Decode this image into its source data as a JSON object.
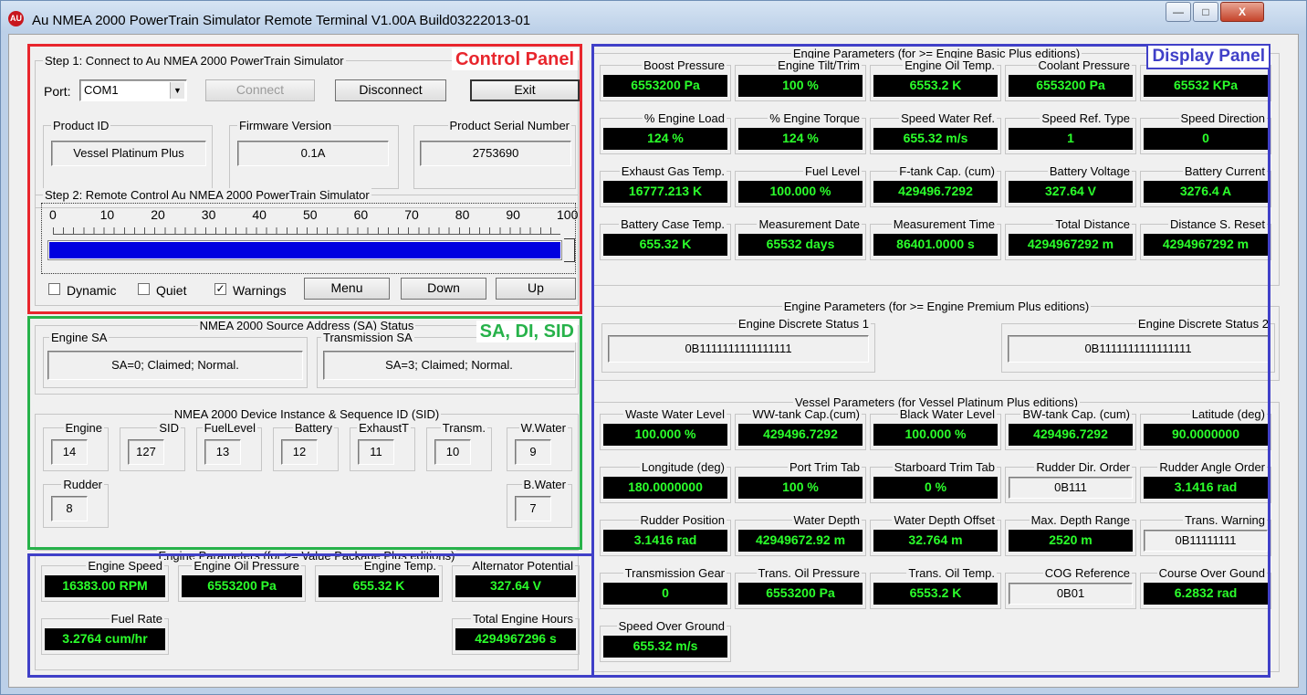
{
  "window": {
    "title": "Au NMEA 2000 PowerTrain Simulator Remote Terminal V1.00A Build03222013-01",
    "icon": "app-logo-icon",
    "controls": {
      "minimize": "—",
      "maximize": "□",
      "close": "X"
    }
  },
  "overlays": {
    "control_panel": {
      "label": "Control Panel",
      "color": "#e8262d"
    },
    "sa_panel": {
      "label": "SA, DI, SID",
      "color": "#27b24a"
    },
    "display_panel": {
      "label": "Display Panel",
      "color": "#4040c8"
    }
  },
  "step1": {
    "title": "Step 1: Connect to Au NMEA 2000 PowerTrain Simulator",
    "port_label": "Port:",
    "port_value": "COM1",
    "connect_label": "Connect",
    "disconnect_label": "Disconnect",
    "exit_label": "Exit",
    "product_id": {
      "label": "Product ID",
      "value": "Vessel Platinum Plus"
    },
    "firmware": {
      "label": "Firmware Version",
      "value": "0.1A"
    },
    "serial": {
      "label": "Product Serial Number",
      "value": "2753690"
    }
  },
  "step2": {
    "title": "Step 2: Remote Control Au NMEA 2000 PowerTrain Simulator",
    "ticks": [
      "0",
      "10",
      "20",
      "30",
      "40",
      "50",
      "60",
      "70",
      "80",
      "90",
      "100"
    ],
    "slider_value": 100,
    "dynamic_label": "Dynamic",
    "dynamic_checked": false,
    "quiet_label": "Quiet",
    "quiet_checked": false,
    "warnings_label": "Warnings",
    "warnings_checked": true,
    "warnings_mark": "✓",
    "menu_label": "Menu",
    "down_label": "Down",
    "up_label": "Up"
  },
  "sa_status": {
    "title": "NMEA 2000 Source Address (SA) Status",
    "engine": {
      "label": "Engine SA",
      "value": "SA=0; Claimed; Normal."
    },
    "transmission": {
      "label": "Transmission SA",
      "value": "SA=3; Claimed; Normal."
    }
  },
  "instance": {
    "title": "NMEA 2000 Device Instance & Sequence ID (SID)",
    "items": [
      {
        "label": "Engine",
        "value": "14"
      },
      {
        "label": "SID",
        "value": "127"
      },
      {
        "label": "FuelLevel",
        "value": "13"
      },
      {
        "label": "Battery",
        "value": "12"
      },
      {
        "label": "ExhaustT",
        "value": "11"
      },
      {
        "label": "Transm.",
        "value": "10"
      },
      {
        "label": "W.Water",
        "value": "9"
      },
      {
        "label": "Rudder",
        "value": "8"
      },
      {
        "label": "B.Water",
        "value": "7"
      }
    ]
  },
  "value_pkg": {
    "title": "Engine Parameters (for >= Value Package Plus editions)",
    "items": [
      {
        "label": "Engine Speed",
        "value": "16383.00 RPM"
      },
      {
        "label": "Engine Oil Pressure",
        "value": "6553200 Pa"
      },
      {
        "label": "Engine Temp.",
        "value": "655.32 K"
      },
      {
        "label": "Alternator Potential",
        "value": "327.64 V"
      },
      {
        "label": "Fuel Rate",
        "value": "3.2764 cum/hr"
      },
      {
        "label": "Total Engine Hours",
        "value": "4294967296 s"
      }
    ]
  },
  "basic_plus": {
    "title": "Engine Parameters (for >= Engine Basic Plus editions)",
    "items": [
      {
        "label": "Boost Pressure",
        "value": "6553200 Pa"
      },
      {
        "label": "Engine Tilt/Trim",
        "value": "100 %"
      },
      {
        "label": "Engine Oil Temp.",
        "value": "6553.2 K"
      },
      {
        "label": "Coolant Pressure",
        "value": "6553200 Pa"
      },
      {
        "label": "Fuel Pressure",
        "value": "65532 KPa"
      },
      {
        "label": "% Engine Load",
        "value": "124 %"
      },
      {
        "label": "% Engine Torque",
        "value": "124 %"
      },
      {
        "label": "Speed Water Ref.",
        "value": "655.32 m/s"
      },
      {
        "label": "Speed Ref. Type",
        "value": "1"
      },
      {
        "label": "Speed Direction",
        "value": "0"
      },
      {
        "label": "Exhaust Gas Temp.",
        "value": "16777.213 K"
      },
      {
        "label": "Fuel Level",
        "value": "100.000 %"
      },
      {
        "label": "F-tank Cap. (cum)",
        "value": "429496.7292"
      },
      {
        "label": "Battery Voltage",
        "value": "327.64 V"
      },
      {
        "label": "Battery Current",
        "value": "3276.4 A"
      },
      {
        "label": "Battery Case Temp.",
        "value": "655.32 K"
      },
      {
        "label": "Measurement Date",
        "value": "65532 days"
      },
      {
        "label": "Measurement Time",
        "value": "86401.0000 s"
      },
      {
        "label": "Total Distance",
        "value": "4294967292 m"
      },
      {
        "label": "Distance S. Reset",
        "value": "4294967292 m"
      }
    ]
  },
  "premium_plus": {
    "title": "Engine Parameters (for >= Engine Premium Plus editions)",
    "status1": {
      "label": "Engine Discrete Status 1",
      "value": "0B1111111111111111"
    },
    "status2": {
      "label": "Engine Discrete Status 2",
      "value": "0B1111111111111111"
    }
  },
  "vessel": {
    "title": "Vessel Parameters (for Vessel Platinum Plus editions)",
    "items": [
      {
        "label": "Waste Water Level",
        "value": "100.000 %",
        "style": "dark"
      },
      {
        "label": "WW-tank Cap.(cum)",
        "value": "429496.7292",
        "style": "dark"
      },
      {
        "label": "Black Water Level",
        "value": "100.000 %",
        "style": "dark"
      },
      {
        "label": "BW-tank Cap. (cum)",
        "value": "429496.7292",
        "style": "dark"
      },
      {
        "label": "Latitude (deg)",
        "value": "90.0000000",
        "style": "dark"
      },
      {
        "label": "Longitude (deg)",
        "value": "180.0000000",
        "style": "dark"
      },
      {
        "label": "Port Trim Tab",
        "value": "100 %",
        "style": "dark"
      },
      {
        "label": "Starboard Trim Tab",
        "value": "0 %",
        "style": "dark"
      },
      {
        "label": "Rudder Dir. Order",
        "value": "0B111",
        "style": "light"
      },
      {
        "label": "Rudder Angle Order",
        "value": "3.1416 rad",
        "style": "dark"
      },
      {
        "label": "Rudder Position",
        "value": "3.1416 rad",
        "style": "dark"
      },
      {
        "label": "Water Depth",
        "value": "42949672.92 m",
        "style": "dark"
      },
      {
        "label": "Water Depth Offset",
        "value": "32.764 m",
        "style": "dark"
      },
      {
        "label": "Max. Depth Range",
        "value": "2520 m",
        "style": "dark"
      },
      {
        "label": "Trans. Warning",
        "value": "0B11111111",
        "style": "light"
      },
      {
        "label": "Transmission Gear",
        "value": "0",
        "style": "dark"
      },
      {
        "label": "Trans. Oil Pressure",
        "value": "6553200 Pa",
        "style": "dark"
      },
      {
        "label": "Trans. Oil Temp.",
        "value": "6553.2 K",
        "style": "dark"
      },
      {
        "label": "COG Reference",
        "value": "0B01",
        "style": "light"
      },
      {
        "label": "Course Over Gound",
        "value": "6.2832 rad",
        "style": "dark"
      },
      {
        "label": "Speed Over Ground",
        "value": "655.32 m/s",
        "style": "dark"
      }
    ]
  }
}
